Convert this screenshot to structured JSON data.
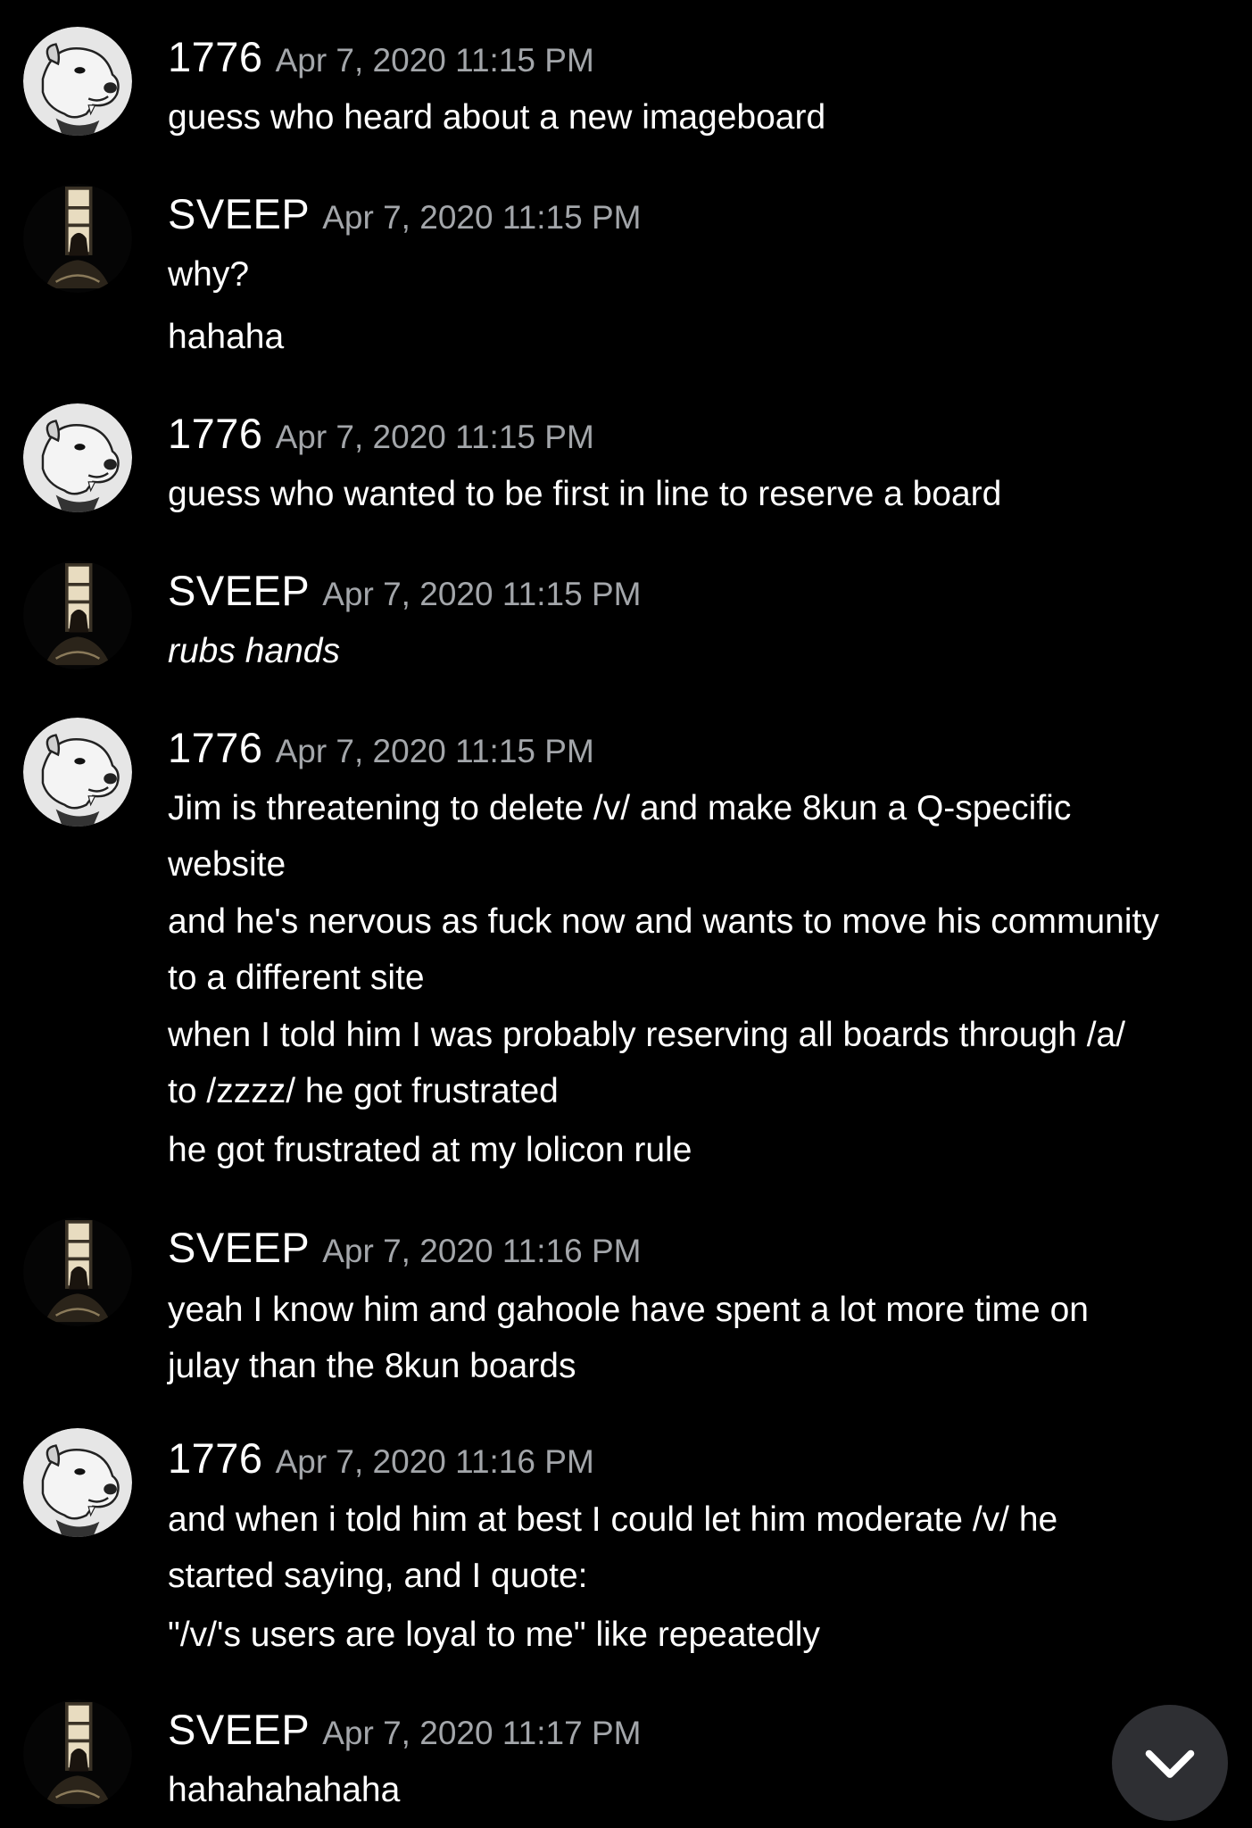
{
  "users": {
    "u1776": {
      "name": "1776",
      "avatar_icon": "dog-cartoon-avatar-icon"
    },
    "sveep": {
      "name": "SVEEP",
      "avatar_icon": "dark-doorway-figure-avatar-icon"
    }
  },
  "messages": [
    {
      "author": "1776",
      "timestamp": "Apr 7, 2020 11:15 PM",
      "lines": [
        "guess who heard about a new imageboard"
      ]
    },
    {
      "author": "SVEEP",
      "timestamp": "Apr 7, 2020 11:15 PM",
      "lines": [
        "why?",
        "hahaha"
      ]
    },
    {
      "author": "1776",
      "timestamp": "Apr 7, 2020 11:15 PM",
      "lines": [
        "guess who wanted to be first in line to reserve a board"
      ]
    },
    {
      "author": "SVEEP",
      "timestamp": "Apr 7, 2020 11:15 PM",
      "lines": [
        "rubs hands"
      ]
    },
    {
      "author": "1776",
      "timestamp": "Apr 7, 2020 11:15 PM",
      "lines": [
        "Jim is threatening to delete /v/ and make 8kun a Q-specific",
        "website",
        "and he's nervous as fuck now and wants to move his community",
        "to a different site",
        "when I told him I was probably reserving all boards through /a/",
        "to /zzzz/ he got frustrated",
        "he got frustrated at my lolicon rule"
      ]
    },
    {
      "author": "SVEEP",
      "timestamp": "Apr 7, 2020 11:16 PM",
      "lines": [
        "yeah I know him and gahoole have spent a lot more time on",
        "julay than the 8kun boards"
      ]
    },
    {
      "author": "1776",
      "timestamp": "Apr 7, 2020 11:16 PM",
      "lines": [
        "and when i told him at best I could let him moderate /v/ he",
        "started saying, and I quote:",
        "\"/v/'s users are loyal to me\" like repeatedly"
      ]
    },
    {
      "author": "SVEEP",
      "timestamp": "Apr 7, 2020 11:17 PM",
      "lines": [
        "hahahahahaha"
      ]
    }
  ],
  "scroll_button": {
    "icon": "chevron-down-icon"
  },
  "colors": {
    "background": "#000000",
    "text": "#ffffff",
    "timestamp": "#a3a6aa",
    "scroll_button": "#2e2f33"
  }
}
